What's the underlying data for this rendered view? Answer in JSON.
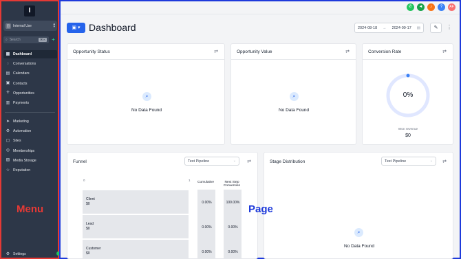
{
  "sidebar": {
    "logo_text": "I",
    "location_label": "Internal Use",
    "search_placeholder": "Search",
    "search_shortcut": "⌘ K",
    "items_primary": [
      {
        "label": "Dashboard",
        "icon": "grid-icon",
        "glyph": "▦",
        "active": true
      },
      {
        "label": "Conversations",
        "icon": "chat-icon",
        "glyph": "◌"
      },
      {
        "label": "Calendars",
        "icon": "calendar-icon",
        "glyph": "▤"
      },
      {
        "label": "Contacts",
        "icon": "contacts-icon",
        "glyph": "▣"
      },
      {
        "label": "Opportunities",
        "icon": "opportunities-icon",
        "glyph": "⁜"
      },
      {
        "label": "Payments",
        "icon": "payments-icon",
        "glyph": "▥"
      }
    ],
    "items_secondary": [
      {
        "label": "Marketing",
        "icon": "send-icon",
        "glyph": "➤"
      },
      {
        "label": "Automation",
        "icon": "automation-icon",
        "glyph": "⚙"
      },
      {
        "label": "Sites",
        "icon": "sites-icon",
        "glyph": "▢"
      },
      {
        "label": "Memberships",
        "icon": "memberships-icon",
        "glyph": "◎"
      },
      {
        "label": "Media Storage",
        "icon": "media-icon",
        "glyph": "▨"
      },
      {
        "label": "Reputation",
        "icon": "star-icon",
        "glyph": "☆"
      }
    ],
    "settings_label": "Settings",
    "overlay_label": "Menu"
  },
  "header": {
    "title": "Dashboard",
    "date_start": "2024-08-18",
    "date_end": "2024-09-17",
    "avatar_initials": "AF",
    "colors": {
      "accent": "#2563eb",
      "phone": "#22c55e",
      "megaphone": "#16a34a",
      "bell": "#f97316",
      "help": "#3b82f6",
      "avatar": "#f87171"
    }
  },
  "cards": {
    "opportunity_status": {
      "title": "Opportunity Status",
      "empty": "No Data Found"
    },
    "opportunity_value": {
      "title": "Opportunity Value",
      "empty": "No Data Found"
    },
    "conversion_rate": {
      "title": "Conversion Rate",
      "percent": "0%",
      "won_label": "Won revenue",
      "won_value": "$0"
    },
    "funnel": {
      "title": "Funnel",
      "pipeline": "Test Pipeline",
      "axis_start": "0",
      "axis_end": "1",
      "col_cumulative": "Cumulative",
      "col_next": "Next Step Conversion",
      "rows": [
        {
          "stage": "Client",
          "value": "$0",
          "cumulative": "0.00%",
          "next": "100.00%"
        },
        {
          "stage": "Lead",
          "value": "$0",
          "cumulative": "0.00%",
          "next": "0.00%"
        },
        {
          "stage": "Customer",
          "value": "$0",
          "cumulative": "0.00%",
          "next": "0.00%"
        }
      ]
    },
    "stage_distribution": {
      "title": "Stage Distribution",
      "pipeline": "Test Pipeline",
      "empty": "No Data Found"
    }
  },
  "page_overlay_label": "Page"
}
